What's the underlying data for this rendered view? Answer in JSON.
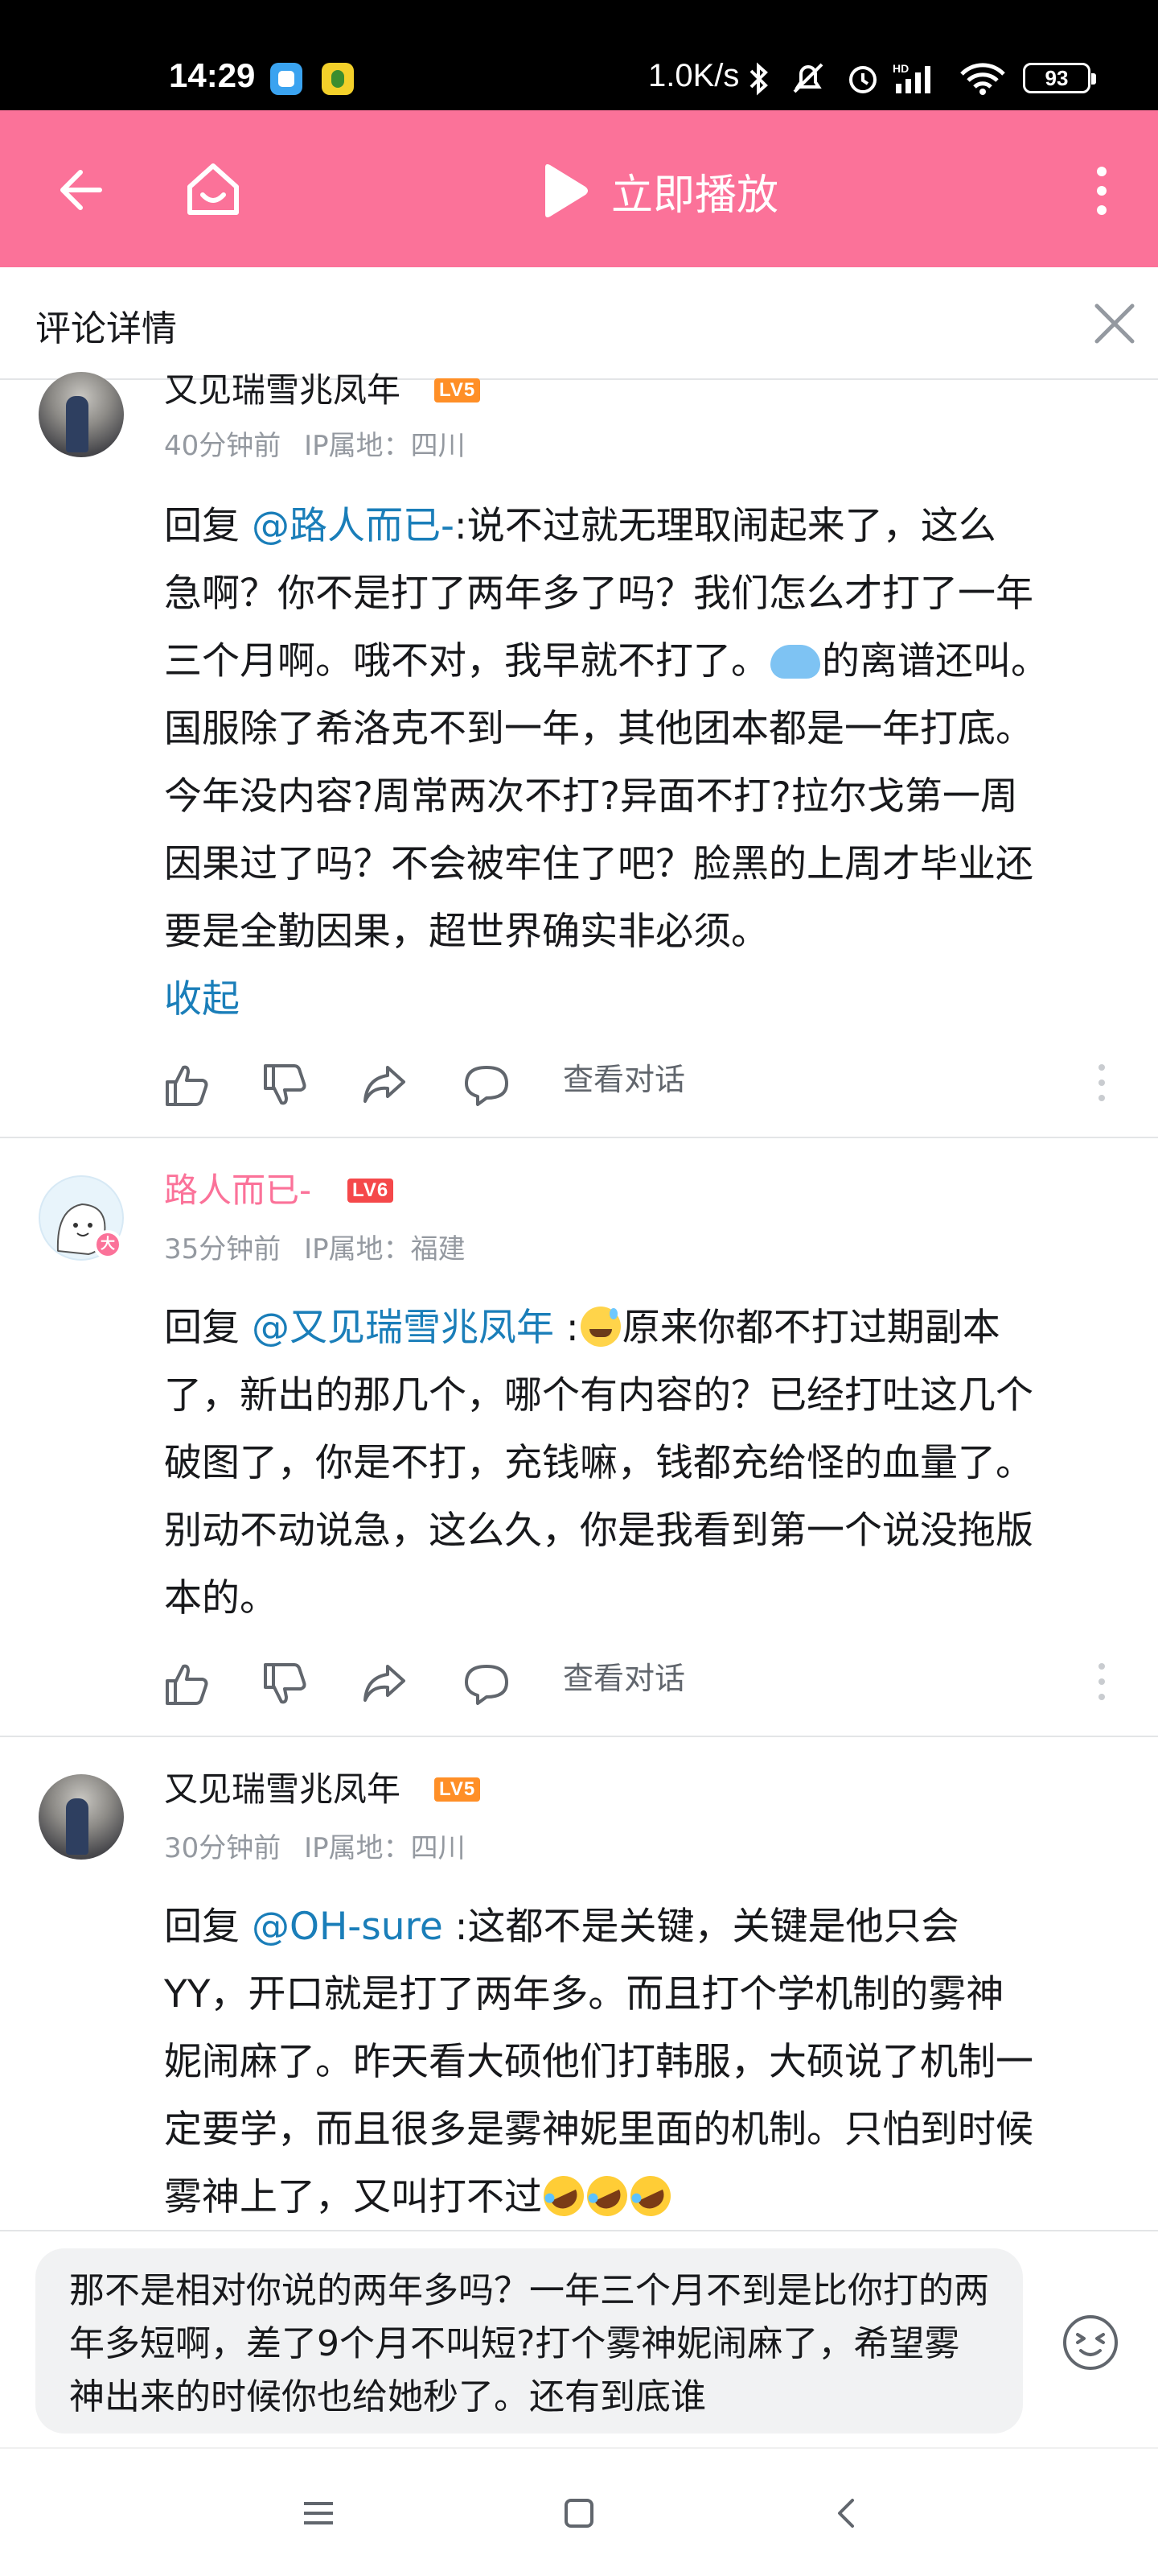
{
  "status_bar": {
    "time": "14:29",
    "net_speed": "1.0K/s",
    "battery": "93"
  },
  "top_bar": {
    "play_label": "立即播放",
    "accent_color": "#fb7299"
  },
  "panel": {
    "title": "评论详情"
  },
  "comments": [
    {
      "username": "又见瑞雪兆凤年",
      "level": "LV5",
      "time": "40分钟前",
      "ip": "IP属地：四川",
      "reply_prefix": "回复 ",
      "mention": "@路人而已-",
      "lines": [
        ":说不过就无理取闹起来了，这么",
        "急啊？你不是打了两年多了吗？我们怎么才打了一年",
        "三个月啊。哦不对，我早就不打了。",
        "的离谱还叫。",
        "国服除了希洛克不到一年，其他团本都是一年打底。",
        "今年没内容?周常两次不打?异面不打?拉尔戈第一周",
        "因果过了吗？不会被牢住了吧？脸黑的上周才毕业还",
        "要是全勤因果，超世界确实非必须。"
      ],
      "collapse": "收起",
      "view_conversation": "查看对话"
    },
    {
      "username": "路人而已-",
      "level": "LV6",
      "time": "35分钟前",
      "ip": "IP属地：福建",
      "reply_prefix": "回复 ",
      "mention": "@又见瑞雪兆凤年",
      "lines": [
        " :",
        "原来你都不打过期副本",
        "了，新出的那几个，哪个有内容的？已经打吐这几个",
        "破图了，你是不打，充钱嘛，钱都充给怪的血量了。",
        "别动不动说急，这么久，你是我看到第一个说没拖版",
        "本的。"
      ],
      "view_conversation": "查看对话"
    },
    {
      "username": "又见瑞雪兆凤年",
      "level": "LV5",
      "time": "30分钟前",
      "ip": "IP属地：四川",
      "reply_prefix": "回复 ",
      "mention": "@OH-sure",
      "lines": [
        " :这都不是关键，关键是他只会",
        "YY，开口就是打了两年多。而且打个学机制的雾神",
        "妮闹麻了。昨天看大硕他们打韩服，大硕说了机制一",
        "定要学，而且很多是雾神妮里面的机制。只怕到时候",
        "雾神上了，又叫打不过"
      ]
    }
  ],
  "composer": {
    "text": "那不是相对你说的两年多吗？一年三个月不到是比你打的两年多短啊，差了9个月不叫短?打个雾神妮闹麻了，希望雾神出来的时候你也给她秒了。还有到底谁"
  },
  "icons": [
    "back-arrow-icon",
    "home-icon",
    "play-icon",
    "more-vertical-icon",
    "close-icon",
    "thumb-up-icon",
    "thumb-down-icon",
    "share-icon",
    "comment-bubble-icon",
    "emoji-face-icon"
  ]
}
